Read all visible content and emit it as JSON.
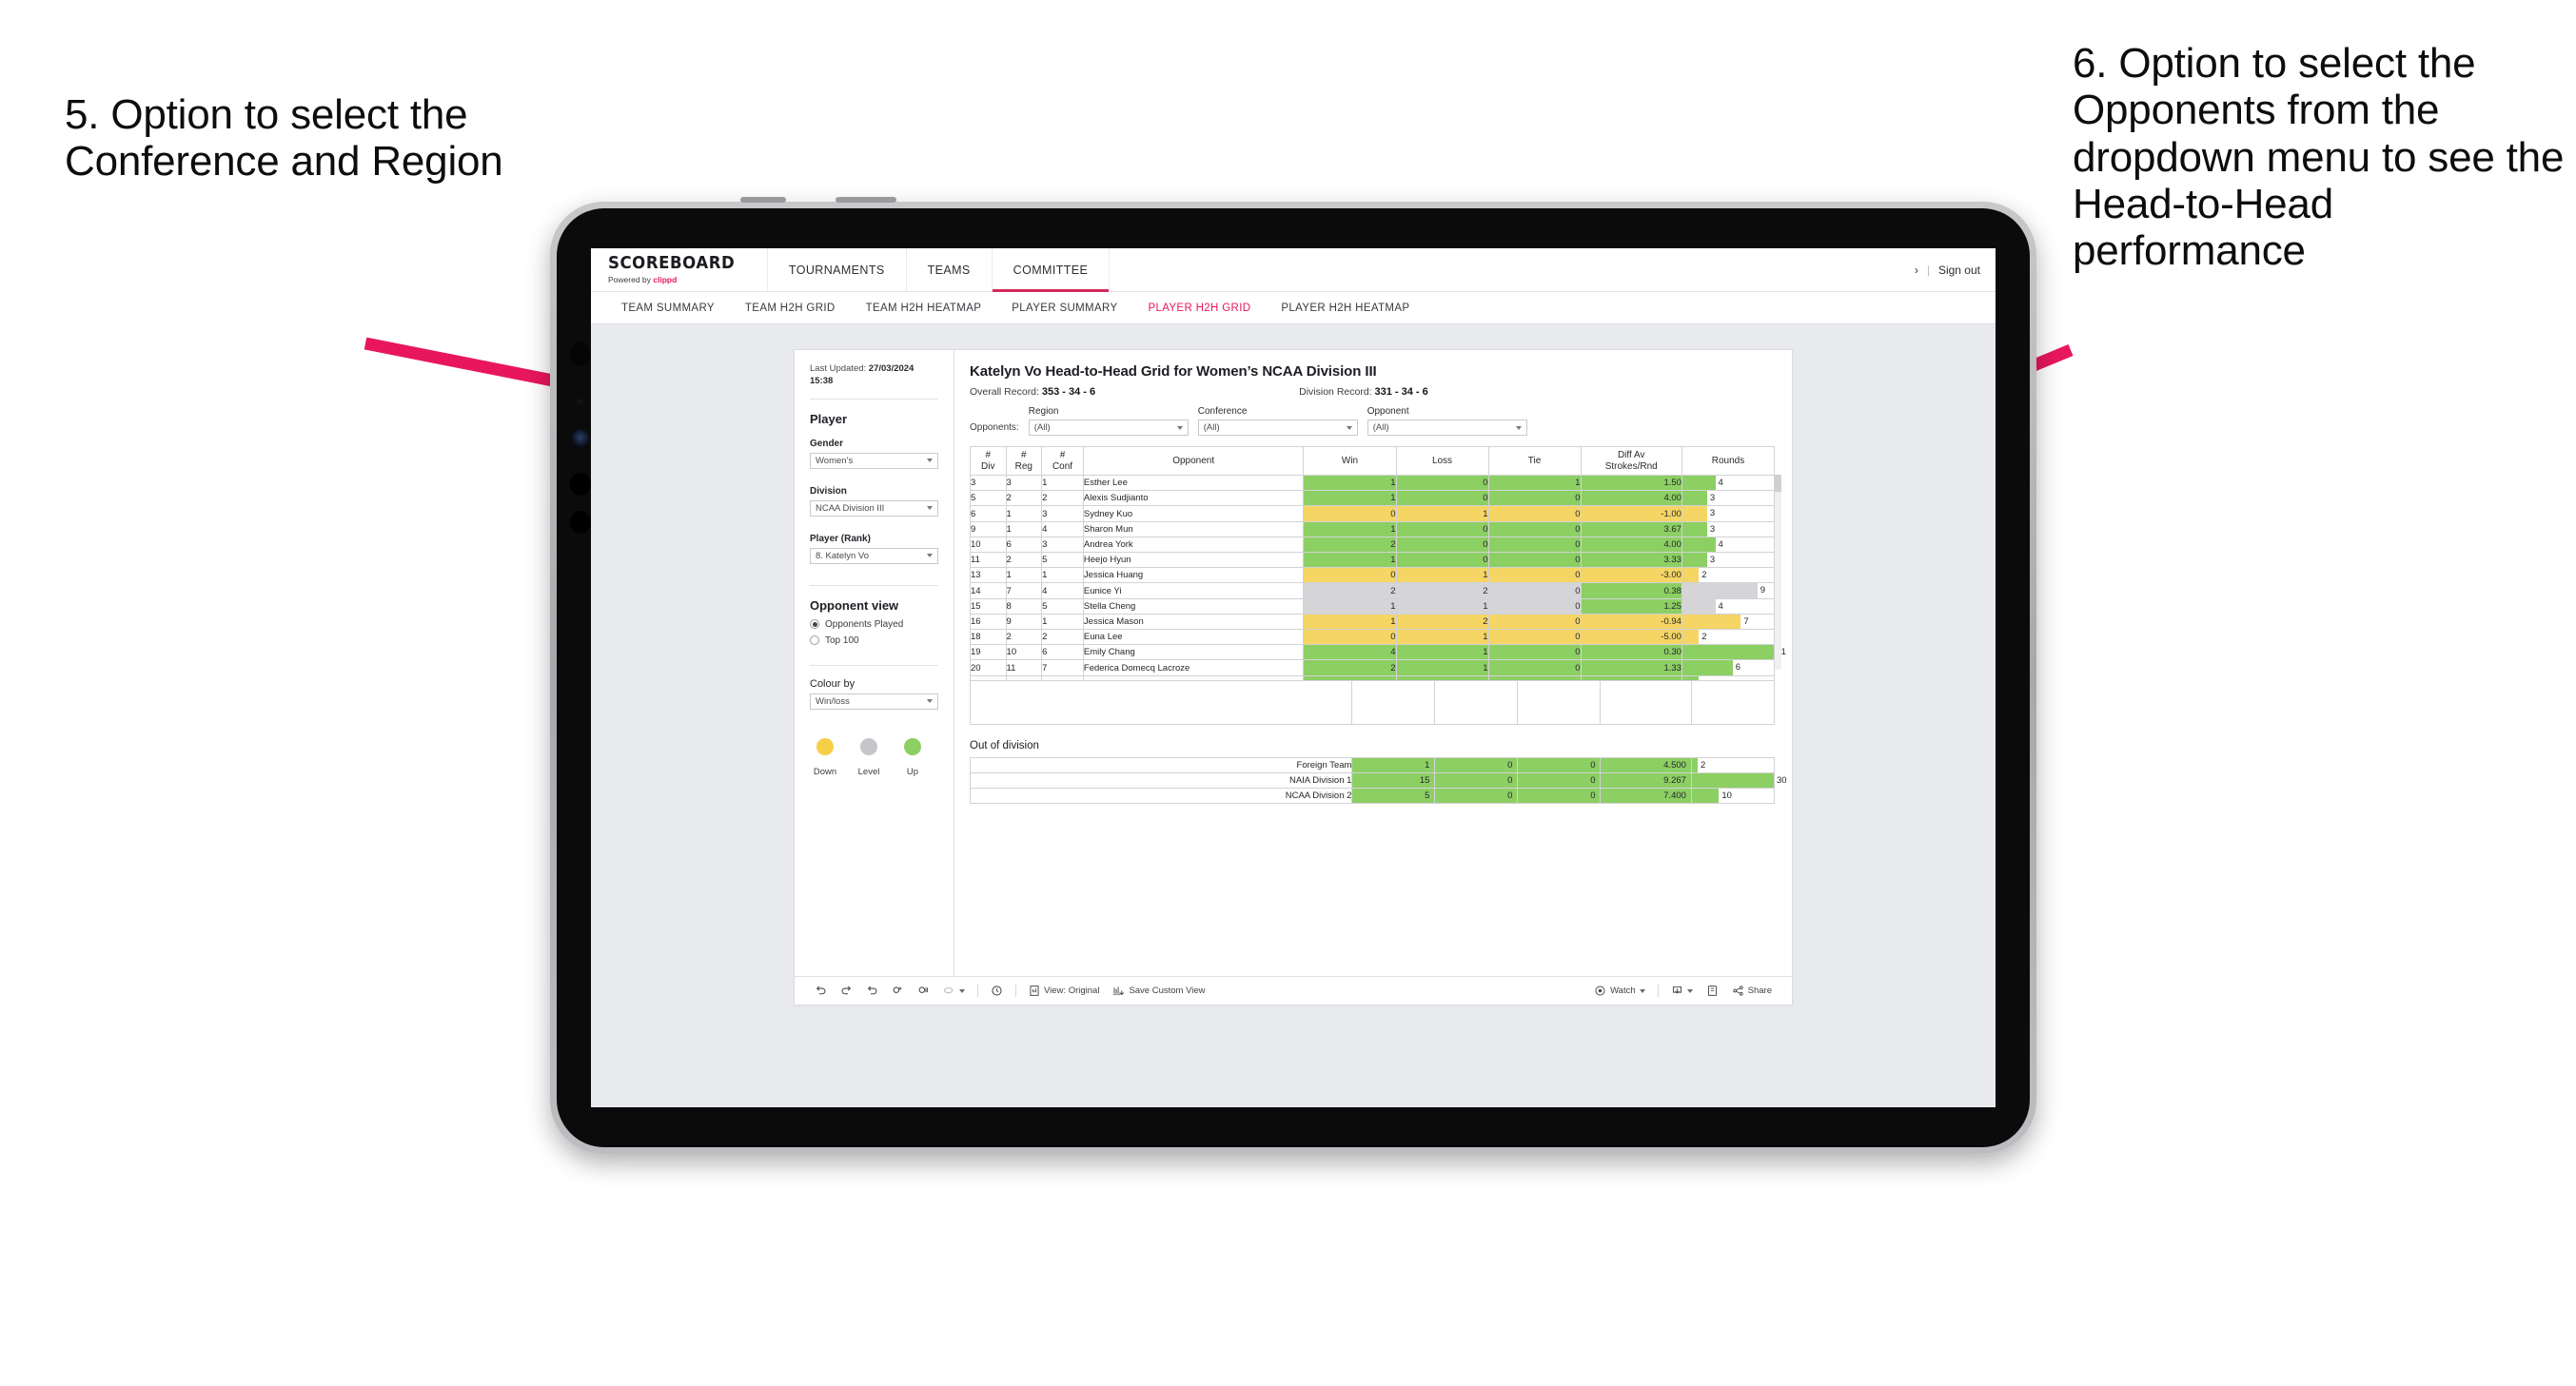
{
  "annotations": {
    "left": "5. Option to select the Conference and Region",
    "right": "6. Option to select the Opponents from the dropdown menu to see the Head-to-Head performance",
    "arrow_color": "#e8175d"
  },
  "app": {
    "brand": {
      "name": "SCOREBOARD",
      "powered_prefix": "Powered by",
      "powered_brand": "clippd"
    },
    "topnav": [
      {
        "label": "TOURNAMENTS",
        "active": false
      },
      {
        "label": "TEAMS",
        "active": false
      },
      {
        "label": "COMMITTEE",
        "active": true
      }
    ],
    "topnav_right": {
      "chevron": "›",
      "separator": "|",
      "signout": "Sign out"
    },
    "subnav": [
      {
        "label": "TEAM SUMMARY",
        "active": false
      },
      {
        "label": "TEAM H2H GRID",
        "active": false
      },
      {
        "label": "TEAM H2H HEATMAP",
        "active": false
      },
      {
        "label": "PLAYER SUMMARY",
        "active": false
      },
      {
        "label": "PLAYER H2H GRID",
        "active": true
      },
      {
        "label": "PLAYER H2H HEATMAP",
        "active": false
      }
    ],
    "accent": "#e8175d"
  },
  "sidebar": {
    "last_updated_label": "Last Updated:",
    "last_updated_date": "27/03/2024",
    "last_updated_time": "15:38",
    "player_heading": "Player",
    "gender": {
      "label": "Gender",
      "value": "Women’s"
    },
    "division": {
      "label": "Division",
      "value": "NCAA Division III"
    },
    "player_rank": {
      "label": "Player (Rank)",
      "value": "8. Katelyn Vo"
    },
    "opponent_view": {
      "heading": "Opponent view",
      "options": [
        {
          "label": "Opponents Played",
          "selected": true
        },
        {
          "label": "Top 100",
          "selected": false
        }
      ]
    },
    "colour_by": {
      "label": "Colour by",
      "value": "Win/loss"
    },
    "legend": [
      {
        "label": "Down",
        "color": "#f5cf46"
      },
      {
        "label": "Level",
        "color": "#c6c6ca"
      },
      {
        "label": "Up",
        "color": "#8ccf63"
      }
    ]
  },
  "main": {
    "title": "Katelyn Vo Head-to-Head Grid for Women’s NCAA Division III",
    "overall_record_label": "Overall Record:",
    "overall_record_value": "353 - 34 - 6",
    "division_record_label": "Division Record:",
    "division_record_value": "331 -  34 - 6",
    "filters_lead": "Opponents:",
    "filters": [
      {
        "label": "Region",
        "value": "(All)"
      },
      {
        "label": "Conference",
        "value": "(All)"
      },
      {
        "label": "Opponent",
        "value": "(All)"
      }
    ]
  },
  "chart_data": {
    "type": "table",
    "title": "Katelyn Vo Head-to-Head Grid for Women’s NCAA Division III",
    "columns": [
      "# Div",
      "# Reg",
      "# Conf",
      "Opponent",
      "Win",
      "Loss",
      "Tie",
      "Diff Av Strokes/Rnd",
      "Rounds"
    ],
    "header_lines": [
      [
        "#",
        "Div"
      ],
      [
        "#",
        "Reg"
      ],
      [
        "#",
        "Conf"
      ],
      [
        "Opponent"
      ],
      [
        "Win"
      ],
      [
        "Loss"
      ],
      [
        "Tie"
      ],
      [
        "Diff Av",
        "Strokes/Rnd"
      ],
      [
        "Rounds"
      ]
    ],
    "colour_scale": {
      "up": "#8ccf63",
      "level": "#d5d5d8",
      "down": "#f5d563",
      "none": "#ffffff"
    },
    "rounds_max": 11,
    "rows": [
      {
        "div": "3",
        "reg": "3",
        "conf": "1",
        "opponent": "Esther Lee",
        "win": "1",
        "loss": "0",
        "tie": "1",
        "diff": "1.50",
        "rounds": 4,
        "state": "up"
      },
      {
        "div": "5",
        "reg": "2",
        "conf": "2",
        "opponent": "Alexis Sudjianto",
        "win": "1",
        "loss": "0",
        "tie": "0",
        "diff": "4.00",
        "rounds": 3,
        "state": "up"
      },
      {
        "div": "6",
        "reg": "1",
        "conf": "3",
        "opponent": "Sydney Kuo",
        "win": "0",
        "loss": "1",
        "tie": "0",
        "diff": "-1.00",
        "rounds": 3,
        "state": "down"
      },
      {
        "div": "9",
        "reg": "1",
        "conf": "4",
        "opponent": "Sharon Mun",
        "win": "1",
        "loss": "0",
        "tie": "0",
        "diff": "3.67",
        "rounds": 3,
        "state": "up"
      },
      {
        "div": "10",
        "reg": "6",
        "conf": "3",
        "opponent": "Andrea York",
        "win": "2",
        "loss": "0",
        "tie": "0",
        "diff": "4.00",
        "rounds": 4,
        "state": "up"
      },
      {
        "div": "11",
        "reg": "2",
        "conf": "5",
        "opponent": "Heejo Hyun",
        "win": "1",
        "loss": "0",
        "tie": "0",
        "diff": "3.33",
        "rounds": 3,
        "state": "up"
      },
      {
        "div": "13",
        "reg": "1",
        "conf": "1",
        "opponent": "Jessica Huang",
        "win": "0",
        "loss": "1",
        "tie": "0",
        "diff": "-3.00",
        "rounds": 2,
        "state": "down"
      },
      {
        "div": "14",
        "reg": "7",
        "conf": "4",
        "opponent": "Eunice Yi",
        "win": "2",
        "loss": "2",
        "tie": "0",
        "diff": "0.38",
        "rounds": 9,
        "state": "level",
        "diff_state": "up"
      },
      {
        "div": "15",
        "reg": "8",
        "conf": "5",
        "opponent": "Stella Cheng",
        "win": "1",
        "loss": "1",
        "tie": "0",
        "diff": "1.25",
        "rounds": 4,
        "state": "level",
        "diff_state": "up"
      },
      {
        "div": "16",
        "reg": "9",
        "conf": "1",
        "opponent": "Jessica Mason",
        "win": "1",
        "loss": "2",
        "tie": "0",
        "diff": "-0.94",
        "rounds": 7,
        "state": "down"
      },
      {
        "div": "18",
        "reg": "2",
        "conf": "2",
        "opponent": "Euna Lee",
        "win": "0",
        "loss": "1",
        "tie": "0",
        "diff": "-5.00",
        "rounds": 2,
        "state": "down"
      },
      {
        "div": "19",
        "reg": "10",
        "conf": "6",
        "opponent": "Emily Chang",
        "win": "4",
        "loss": "1",
        "tie": "0",
        "diff": "0.30",
        "rounds": 11,
        "state": "up"
      },
      {
        "div": "20",
        "reg": "11",
        "conf": "7",
        "opponent": "Federica Domecq Lacroze",
        "win": "2",
        "loss": "1",
        "tie": "0",
        "diff": "1.33",
        "rounds": 6,
        "state": "up"
      }
    ],
    "clipped_row": {
      "state": "up",
      "rounds": 2
    },
    "out_of_division": {
      "title": "Out of division",
      "rounds_max": 30,
      "rows": [
        {
          "name": "Foreign Team",
          "win": "1",
          "loss": "0",
          "tie": "0",
          "diff": "4.500",
          "rounds": 2,
          "state": "up"
        },
        {
          "name": "NAIA Division 1",
          "win": "15",
          "loss": "0",
          "tie": "0",
          "diff": "9.267",
          "rounds": 30,
          "state": "up"
        },
        {
          "name": "NCAA Division 2",
          "win": "5",
          "loss": "0",
          "tie": "0",
          "diff": "7.400",
          "rounds": 10,
          "state": "up"
        }
      ]
    }
  },
  "toolbar": {
    "view_label": "View: Original",
    "save_label": "Save Custom View",
    "watch_label": "Watch",
    "share_label": "Share"
  }
}
